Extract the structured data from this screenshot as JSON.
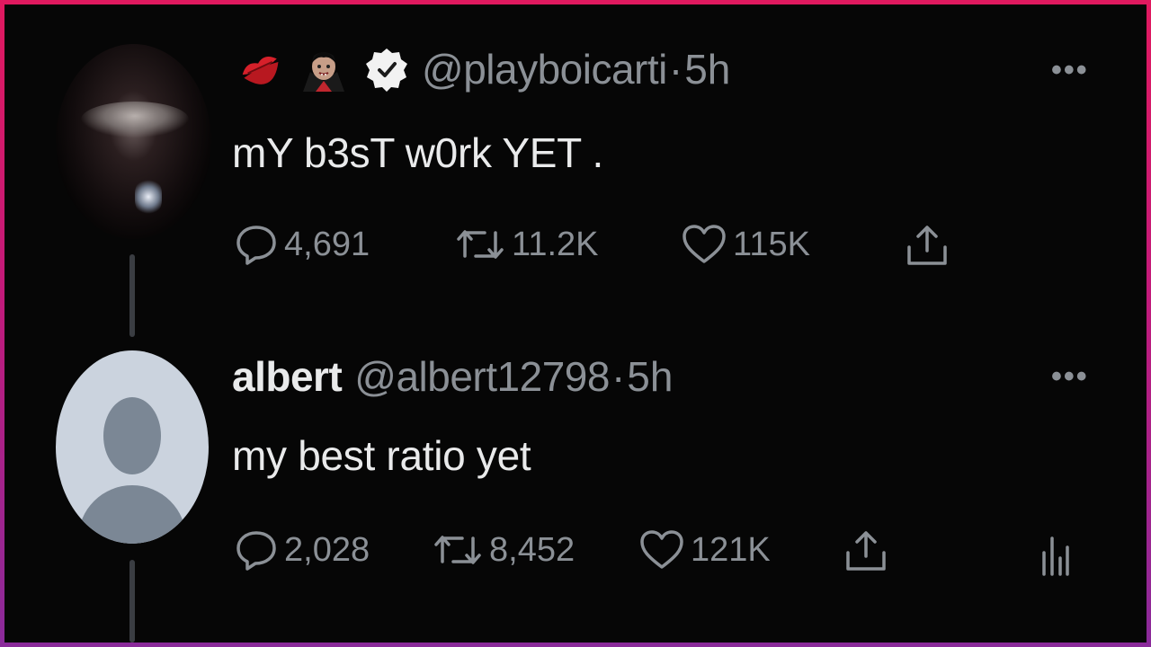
{
  "tweet1": {
    "handle": "@playboicarti",
    "separator": "·",
    "time": "5h",
    "text": "mY b3sT w0rk YET .",
    "emojis": [
      "kiss-mark",
      "vampire",
      "verified-badge"
    ],
    "stats": {
      "replies": "4,691",
      "retweets": "11.2K",
      "likes": "115K"
    },
    "more_label": "•••"
  },
  "tweet2": {
    "name": "albert",
    "handle": "@albert12798",
    "separator": "·",
    "time": "5h",
    "text": "my best ratio yet",
    "stats": {
      "replies": "2,028",
      "retweets": "8,452",
      "likes": "121K"
    },
    "more_label": "•••"
  },
  "colors": {
    "background": "#060606",
    "text_primary": "#e9eaeb",
    "text_secondary": "#8b9096",
    "frame_gradient": [
      "#e0195f",
      "#8a2a9a"
    ]
  }
}
